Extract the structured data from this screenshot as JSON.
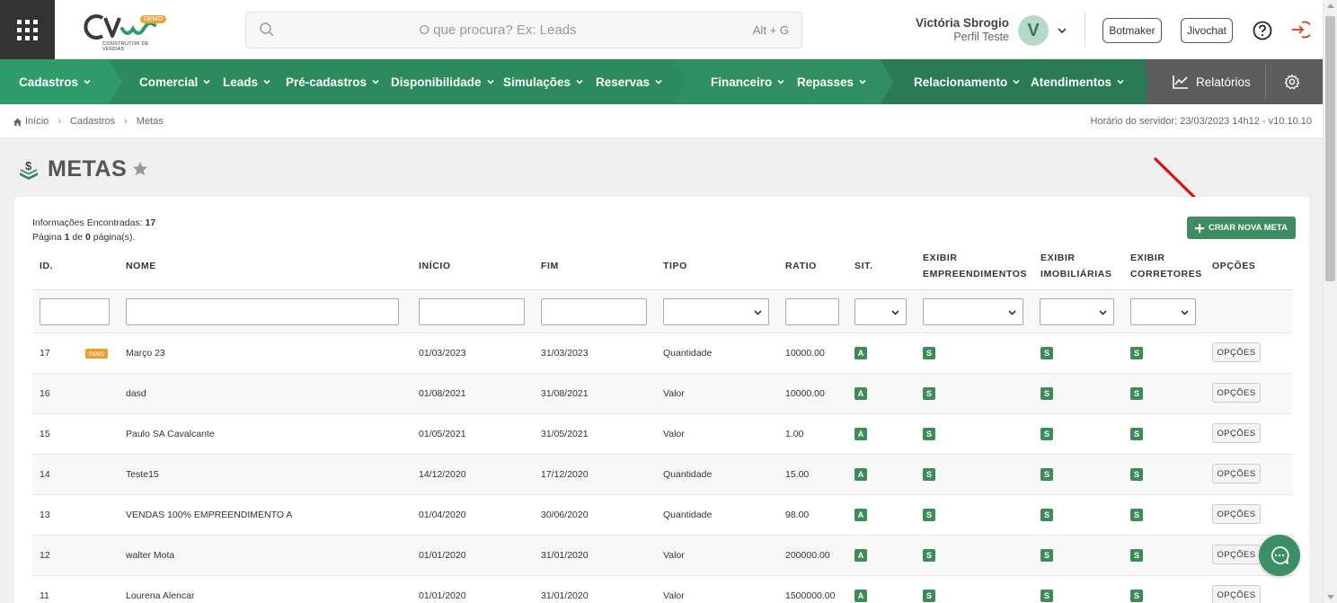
{
  "header": {
    "logo_text": "CV",
    "logo_badge": "DEMO",
    "logo_subtitle": "CONSTRUTOR DE VENDAS",
    "search_placeholder": "O que procura? Ex: Leads",
    "search_shortcut": "Alt + G",
    "user_name": "Victória Sbrogio",
    "user_profile": "Perfil Teste",
    "avatar_initial": "V",
    "botmaker_label": "Botmaker",
    "jivochat_label": "Jivochat"
  },
  "nav": {
    "items": [
      {
        "label": "Cadastros"
      },
      {
        "label": "Comercial"
      },
      {
        "label": "Leads"
      },
      {
        "label": "Pré-cadastros"
      },
      {
        "label": "Disponibilidade"
      },
      {
        "label": "Simulações"
      },
      {
        "label": "Reservas"
      },
      {
        "label": "Financeiro"
      },
      {
        "label": "Repasses"
      },
      {
        "label": "Relacionamento"
      },
      {
        "label": "Atendimentos"
      }
    ],
    "reports_label": "Relatórios"
  },
  "breadcrumb": {
    "items": [
      "Início",
      "Cadastros",
      "Metas"
    ],
    "server_time": "Horário do servidor: 23/03/2023 14h12 - v10.10.10"
  },
  "page": {
    "title": "METAS",
    "info_found_label": "Informações Encontradas:",
    "info_found_count": "17",
    "info_page_label": "Página",
    "info_page_current": "1",
    "info_page_of": "de",
    "info_page_total": "0",
    "info_page_suffix": "página(s).",
    "create_button": "CRIAR NOVA META"
  },
  "table": {
    "headers": {
      "id": "ID.",
      "nome": "NOME",
      "inicio": "INÍCIO",
      "fim": "FIM",
      "tipo": "TIPO",
      "ratio": "RATIO",
      "sit": "SIT.",
      "emp_1": "EXIBIR",
      "emp_2": "EMPREENDIMENTOS",
      "imo_1": "EXIBIR",
      "imo_2": "IMOBILIÁRIAS",
      "cor_1": "EXIBIR",
      "cor_2": "CORRETORES",
      "opcoes": "OPÇÕES"
    },
    "new_badge": "novo",
    "options_label": "OPÇÕES",
    "rows": [
      {
        "id": "17",
        "nome": "Março 23",
        "inicio": "01/03/2023",
        "fim": "31/03/2023",
        "tipo": "Quantidade",
        "ratio": "10000.00",
        "sit": "A",
        "emp": "S",
        "imo": "S",
        "cor": "S"
      },
      {
        "id": "16",
        "nome": "dasd",
        "inicio": "01/08/2021",
        "fim": "31/08/2021",
        "tipo": "Valor",
        "ratio": "10000.00",
        "sit": "A",
        "emp": "S",
        "imo": "S",
        "cor": "S"
      },
      {
        "id": "15",
        "nome": "Paulo SA Cavalcante",
        "inicio": "01/05/2021",
        "fim": "31/05/2021",
        "tipo": "Valor",
        "ratio": "1.00",
        "sit": "A",
        "emp": "S",
        "imo": "S",
        "cor": "S"
      },
      {
        "id": "14",
        "nome": "Teste15",
        "inicio": "14/12/2020",
        "fim": "17/12/2020",
        "tipo": "Quantidade",
        "ratio": "15.00",
        "sit": "A",
        "emp": "S",
        "imo": "S",
        "cor": "S"
      },
      {
        "id": "13",
        "nome": "VENDAS 100% EMPREENDIMENTO A",
        "inicio": "01/04/2020",
        "fim": "30/06/2020",
        "tipo": "Quantidade",
        "ratio": "98.00",
        "sit": "A",
        "emp": "S",
        "imo": "S",
        "cor": "S"
      },
      {
        "id": "12",
        "nome": "walter Mota",
        "inicio": "01/01/2020",
        "fim": "31/01/2020",
        "tipo": "Valor",
        "ratio": "200000.00",
        "sit": "A",
        "emp": "S",
        "imo": "S",
        "cor": "S"
      },
      {
        "id": "11",
        "nome": "Lourena Alencar",
        "inicio": "01/01/2020",
        "fim": "31/01/2020",
        "tipo": "Valor",
        "ratio": "1500000.00",
        "sit": "A",
        "emp": "S",
        "imo": "S",
        "cor": "S"
      }
    ]
  },
  "colors": {
    "nav_green": "#2c8a5e",
    "badge_green": "#3c8b58",
    "new_badge": "#e9a12e",
    "dark_grey": "#5d5d5d"
  }
}
